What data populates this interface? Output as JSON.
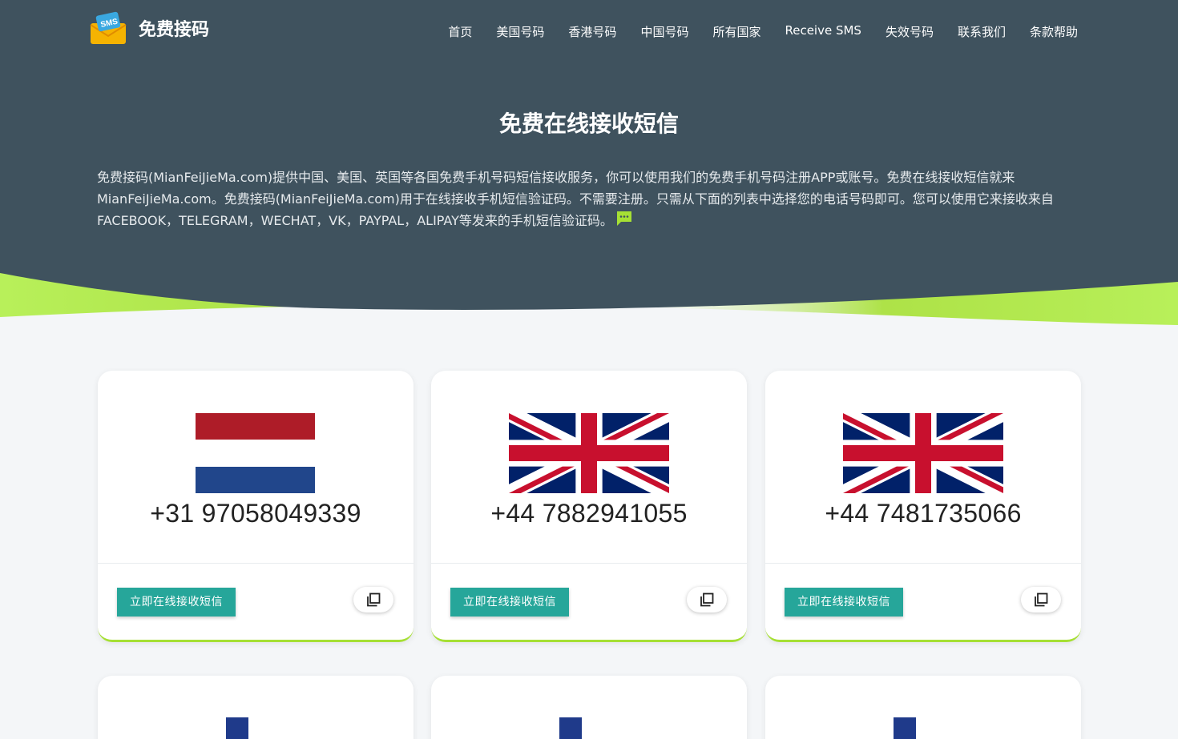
{
  "brand": {
    "name": "免费接码",
    "logo_icon": "sms-envelope-icon",
    "logo_text": "SMS"
  },
  "nav": [
    {
      "label": "首页"
    },
    {
      "label": "美国号码"
    },
    {
      "label": "香港号码"
    },
    {
      "label": "中国号码"
    },
    {
      "label": "所有国家"
    },
    {
      "label": "Receive SMS"
    },
    {
      "label": "失效号码"
    },
    {
      "label": "联系我们"
    },
    {
      "label": "条款帮助"
    }
  ],
  "hero": {
    "title": "免费在线接收短信",
    "description": "免费接码(MianFeiJieMa.com)提供中国、美国、英国等各国免费手机号码短信接收服务，你可以使用我们的免费手机号码注册APP或账号。免费在线接收短信就来MianFeiJieMa.com。免费接码(MianFeiJieMa.com)用于在线接收手机短信验证码。不需要注册。只需从下面的列表中选择您的电话号码即可。您可以使用它来接收来自FACEBOOK，TELEGRAM，WECHAT，VK，PAYPAL，ALIPAY等发来的手机短信验证码。",
    "icon": "chat-bubble-icon"
  },
  "colors": {
    "hero_bg": "#3f525e",
    "accent_green": "#a6e034",
    "button_teal": "#26a69a"
  },
  "cards": [
    {
      "flag": "netherlands-flag",
      "number": "+31 97058049339",
      "button": "立即在线接收短信",
      "copy_icon": "copy-icon"
    },
    {
      "flag": "uk-flag",
      "number": "+44 7882941055",
      "button": "立即在线接收短信",
      "copy_icon": "copy-icon"
    },
    {
      "flag": "uk-flag",
      "number": "+44 7481735066",
      "button": "立即在线接收短信",
      "copy_icon": "copy-icon"
    }
  ]
}
